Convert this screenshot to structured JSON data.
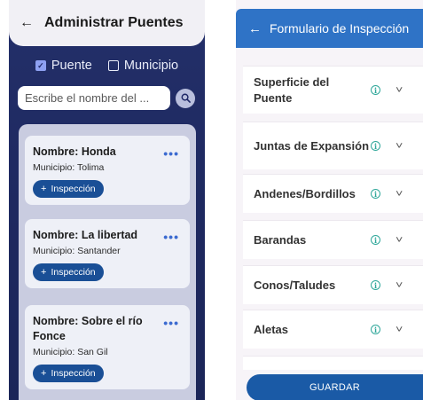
{
  "bridge_admin": {
    "title": "Administrar Puentes",
    "filters": [
      {
        "label": "Puente",
        "checked": true
      },
      {
        "label": "Municipio",
        "checked": false
      }
    ],
    "search": {
      "placeholder": "Escribe el nombre del ..."
    },
    "bridges": [
      {
        "name": "Nombre: Honda",
        "municipio": "Municipio: Tolima",
        "action": "Inspección"
      },
      {
        "name": "Nombre: La libertad",
        "municipio": "Municipio: Santander",
        "action": "Inspección"
      },
      {
        "name": "Nombre: Sobre el río Fonce",
        "municipio": "Municipio: San Gil",
        "action": "Inspección"
      }
    ]
  },
  "inspection_form": {
    "title": "Formulario de Inspección",
    "sections": [
      {
        "label": "Superficie del Puente"
      },
      {
        "label": "Juntas de Expansión"
      },
      {
        "label": "Andenes/Bordillos"
      },
      {
        "label": "Barandas"
      },
      {
        "label": "Conos/Taludes"
      },
      {
        "label": "Aletas"
      }
    ],
    "save_label": "GUARDAR"
  },
  "colors": {
    "admin_background": "#1f2a62",
    "form_header": "#2f73c6",
    "primary_button": "#1a4f96",
    "info_icon": "#2fa79a"
  },
  "icons": [
    "back-arrow-icon",
    "check-icon",
    "search-icon",
    "more-dots-icon",
    "plus-icon",
    "info-icon",
    "chevron-down-icon"
  ]
}
